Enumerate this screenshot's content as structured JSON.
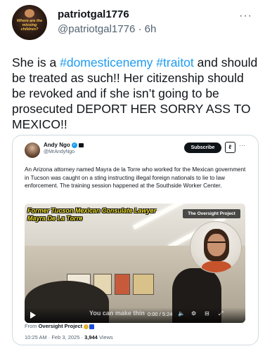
{
  "author": {
    "display_name": "patriotgal1776",
    "handle": "@patriotgal1776",
    "time_ago": "6h",
    "avatar_text": "Where are the missing children?"
  },
  "post": {
    "text_before_tag1": "She is a ",
    "tag1": "#domesticenemy",
    "tag2": "#traitot",
    "text_after": " and should be treated as such!! Her citizenship should be revoked and if she isn’t going to be prosecuted DEPORT HER SORRY ASS TO MEXICO!!"
  },
  "quote": {
    "name": "Andy Ngo",
    "handle": "@MrAndyNgo",
    "subscribe_label": "Subscribe",
    "text": "An Arizona attorney named Mayra de la Torre who worked for the Mexican government in Tucson was caught on a sting instructing illegal foreign nationals to lie to law enforcement. The training session happened at the Southside Worker Center.",
    "video": {
      "caption_line1": "Former Tucson Mexican Consulate Lawyer",
      "caption_line2": "Mayra De La Torre",
      "watermark": "The Oversight Project",
      "subtitle": "You can make thin",
      "time": "0:00 / 5:24"
    },
    "from_label": "From",
    "from_source": "Oversight Project",
    "timestamp": "10:25 AM · Feb 3, 2025 ·",
    "views": "3,944",
    "views_label": "Views"
  },
  "colors": {
    "link": "#1d9bf0",
    "text": "#0f1419",
    "muted": "#536471",
    "caption_yellow": "#f3e12c"
  },
  "icons": [
    "more-icon",
    "verified-icon",
    "grok-icon",
    "play-icon",
    "volume-icon",
    "settings-icon",
    "captions-icon",
    "fullscreen-icon"
  ]
}
